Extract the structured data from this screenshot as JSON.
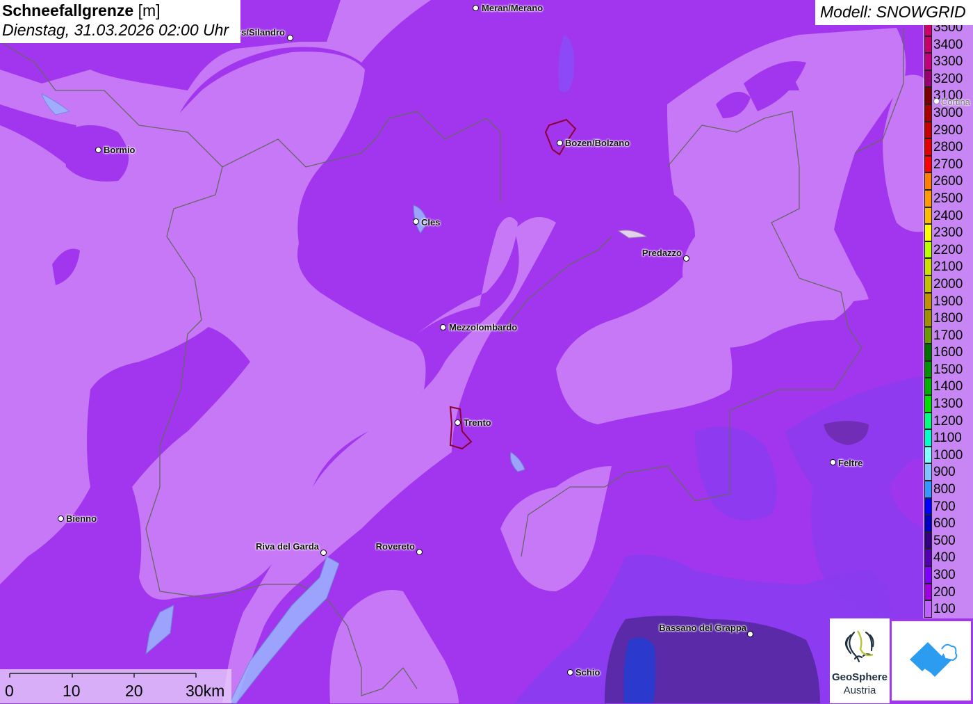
{
  "header": {
    "title_bold": "Schneefallgrenze",
    "title_unit": "[m]",
    "subtitle": "Dienstag, 31.03.2026 02:00 Uhr",
    "model": "Modell: SNOWGRID"
  },
  "cities": [
    {
      "name": "Meran/Merano"
    },
    {
      "name": "Schlanders/Silandro"
    },
    {
      "name": "Bormio"
    },
    {
      "name": "Bozen/Bolzano"
    },
    {
      "name": "Cles"
    },
    {
      "name": "Predazzo"
    },
    {
      "name": "Mezzolombardo"
    },
    {
      "name": "Trento"
    },
    {
      "name": "Feltre"
    },
    {
      "name": "Bienno"
    },
    {
      "name": "Riva del Garda"
    },
    {
      "name": "Rovereto"
    },
    {
      "name": "Bassano del Grappa"
    },
    {
      "name": "Schio"
    },
    {
      "name": "Cortina"
    }
  ],
  "legend": [
    {
      "v": "3500",
      "c": "#d0006a"
    },
    {
      "v": "3400",
      "c": "#c8006a"
    },
    {
      "v": "3300",
      "c": "#c4007c"
    },
    {
      "v": "3200",
      "c": "#990070"
    },
    {
      "v": "3100",
      "c": "#7a0000"
    },
    {
      "v": "3000",
      "c": "#a80000"
    },
    {
      "v": "2900",
      "c": "#c40000"
    },
    {
      "v": "2800",
      "c": "#e20000"
    },
    {
      "v": "2700",
      "c": "#ff0000"
    },
    {
      "v": "2600",
      "c": "#ff7f00"
    },
    {
      "v": "2500",
      "c": "#ff9a00"
    },
    {
      "v": "2400",
      "c": "#ffbb00"
    },
    {
      "v": "2300",
      "c": "#ffff00"
    },
    {
      "v": "2200",
      "c": "#bbff00"
    },
    {
      "v": "2100",
      "c": "#cce000"
    },
    {
      "v": "2000",
      "c": "#c2c000"
    },
    {
      "v": "1900",
      "c": "#c09200"
    },
    {
      "v": "1800",
      "c": "#a09000"
    },
    {
      "v": "1700",
      "c": "#6a9a00"
    },
    {
      "v": "1600",
      "c": "#006f00"
    },
    {
      "v": "1500",
      "c": "#008f00"
    },
    {
      "v": "1400",
      "c": "#00b000"
    },
    {
      "v": "1300",
      "c": "#00e000"
    },
    {
      "v": "1200",
      "c": "#00ff80"
    },
    {
      "v": "1100",
      "c": "#00ffc8"
    },
    {
      "v": "1000",
      "c": "#80ffff"
    },
    {
      "v": "900",
      "c": "#80c4ff"
    },
    {
      "v": "800",
      "c": "#3399ff"
    },
    {
      "v": "700",
      "c": "#0000ff"
    },
    {
      "v": "600",
      "c": "#0000c0"
    },
    {
      "v": "500",
      "c": "#300080"
    },
    {
      "v": "400",
      "c": "#5500b0"
    },
    {
      "v": "300",
      "c": "#8000ff"
    },
    {
      "v": "200",
      "c": "#a000e0"
    },
    {
      "v": "100",
      "c": "#c060ff"
    }
  ],
  "scalebar": {
    "labels": [
      "0",
      "10",
      "20",
      "30km"
    ]
  },
  "logos": {
    "geosphere_line1": "GeoSphere",
    "geosphere_line2": "Austria"
  },
  "colors": {
    "base": "#a236ee",
    "light": "#c778f7",
    "blue_zone": "#8a3cf0",
    "dark_zone": "#5a2aa8"
  }
}
